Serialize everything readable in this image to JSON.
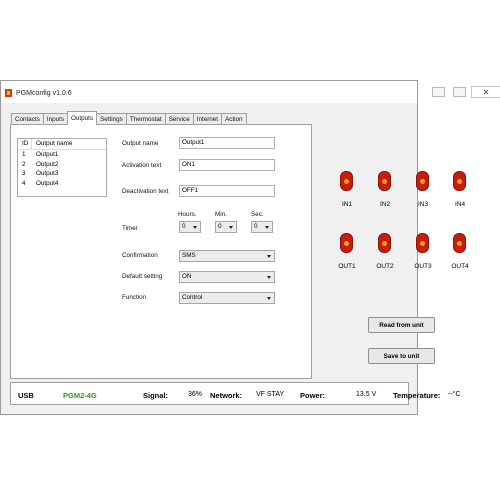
{
  "window": {
    "title": "PGMconfig v1.0.6",
    "close_glyph": "✕"
  },
  "tabs": [
    "Contacts",
    "Inputs",
    "Outputs",
    "Settings",
    "Thermostat",
    "Service",
    "Internet",
    "Action"
  ],
  "active_tab": "Outputs",
  "output_list": {
    "headers": [
      "ID",
      "Output name"
    ],
    "rows": [
      [
        "1",
        "Output1"
      ],
      [
        "2",
        "Output2"
      ],
      [
        "3",
        "Output3"
      ],
      [
        "4",
        "Output4"
      ]
    ]
  },
  "form": {
    "output_name": {
      "label": "Output name",
      "value": "Output1"
    },
    "activation_text": {
      "label": "Activation text",
      "value": "ON1"
    },
    "deactivation_text": {
      "label": "Deactivation text",
      "value": "OFF1"
    },
    "timer": {
      "label": "Timer",
      "hours_label": "Hours.",
      "hours_value": "0",
      "min_label": "Min.",
      "min_value": "0",
      "sec_label": "Sec.",
      "sec_value": "0"
    },
    "confirmation": {
      "label": "Confirmation",
      "value": "SMS"
    },
    "default_setting": {
      "label": "Default setting",
      "value": "ON"
    },
    "function": {
      "label": "Function",
      "value": "Control"
    }
  },
  "indicators": {
    "inputs": [
      "IN1",
      "IN2",
      "IN3",
      "IN4"
    ],
    "outputs": [
      "OUT1",
      "OUT2",
      "OUT3",
      "OUT4"
    ],
    "led_color": "#c81c0e",
    "led_highlight": "#f5a21a"
  },
  "buttons": {
    "read": "Read from unit",
    "save": "Save to unit"
  },
  "status": {
    "connection": "USB",
    "model": "PGM2-4G",
    "model_color": "#2a9a1c",
    "signal_label": "Signal:",
    "signal_value": "36%",
    "network_label": "Network:",
    "network_value": "VF STAY",
    "power_label": "Power:",
    "power_value": "13.5 V",
    "temperature_label": "Temperature:",
    "temperature_value": "--°C"
  }
}
